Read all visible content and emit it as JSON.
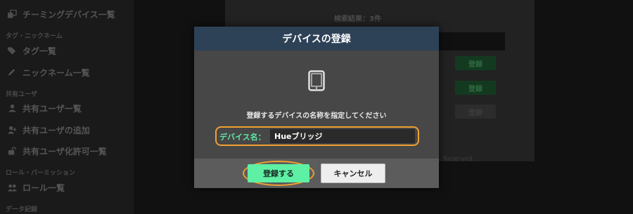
{
  "sidebar": {
    "items": [
      {
        "label": "チーミングデバイス一覧",
        "icon": "clone-icon"
      },
      {
        "section": "タグ・ニックネーム"
      },
      {
        "label": "タグ一覧",
        "icon": "tags-icon"
      },
      {
        "label": "ニックネーム一覧",
        "icon": "pencil-icon"
      },
      {
        "section": "共有ユーザ"
      },
      {
        "label": "共有ユーザ一覧",
        "icon": "user-icon"
      },
      {
        "label": "共有ユーザの追加",
        "icon": "user-plus-icon"
      },
      {
        "label": "共有ユーザ化許可一覧",
        "icon": "unlock-icon"
      },
      {
        "section": "ロール・パーミッション"
      },
      {
        "label": "ロール一覧",
        "icon": "users-icon"
      },
      {
        "section": "データ記録"
      }
    ]
  },
  "background": {
    "search_result": "検索結果：3件",
    "register_label": "登録",
    "footer": "Reserved."
  },
  "modal": {
    "title": "デバイスの登録",
    "icon": "tablet-icon",
    "instruction": "登録するデバイスの名称を指定してください",
    "field_label": "デバイス名：",
    "field_value": "Hueブリッジ",
    "register_button": "登録する",
    "cancel_button": "キャンセル"
  },
  "colors": {
    "header": "#2e4257",
    "accent_green": "#5ef0a4",
    "highlight_orange": "#f0a030",
    "label_green": "#5ee8a8"
  }
}
